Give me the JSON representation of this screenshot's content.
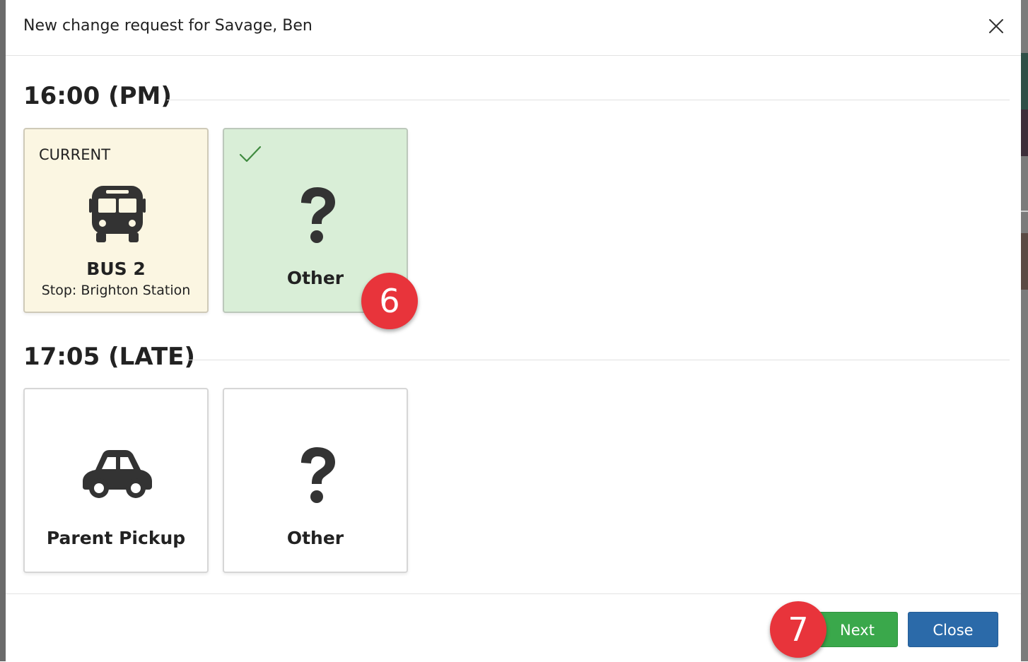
{
  "modal": {
    "title": "New change request for Savage, Ben",
    "close_icon": "close-icon"
  },
  "sections": [
    {
      "heading": "16:00 (PM)",
      "cards": [
        {
          "tag": "CURRENT",
          "icon": "bus-icon",
          "label": "BUS  2",
          "sub": "Stop: Brighton Station",
          "state": "current"
        },
        {
          "icon": "question-icon",
          "label": "Other",
          "state": "selected",
          "check_icon": "checkmark-icon"
        }
      ]
    },
    {
      "heading": "17:05 (LATE)",
      "cards": [
        {
          "icon": "car-icon",
          "label": "Parent Pickup",
          "state": "default"
        },
        {
          "icon": "question-icon",
          "label": "Other",
          "state": "default"
        }
      ]
    }
  ],
  "footer": {
    "next_label": "Next",
    "close_label": "Close"
  },
  "step_markers": [
    {
      "number": "6"
    },
    {
      "number": "7"
    }
  ],
  "colors": {
    "current_card_bg": "#fbf6e2",
    "selected_card_bg": "#d9eed7",
    "next_button": "#3aa84b",
    "close_button": "#2b6aa9",
    "step_marker": "#e8343b",
    "checkmark": "#3f8a3f"
  }
}
